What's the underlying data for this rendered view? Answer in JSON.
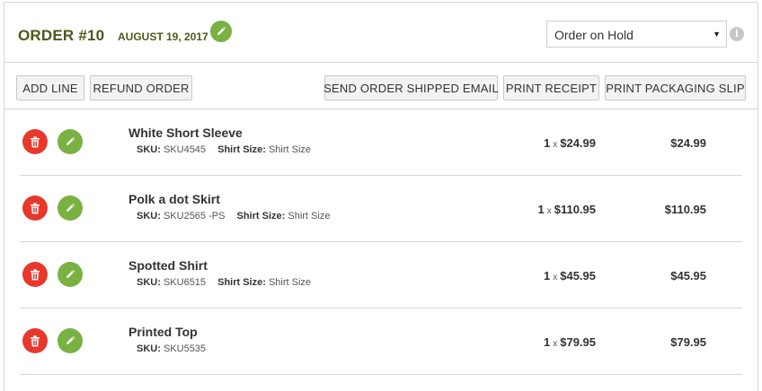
{
  "header": {
    "title": "ORDER #10",
    "date": "AUGUST 19, 2017",
    "status_selected": "Order on Hold",
    "info_icon_glyph": "i"
  },
  "toolbar": {
    "add_line": "ADD LINE",
    "refund_order": "REFUND ORDER",
    "send_shipped_email": "SEND ORDER SHIPPED EMAIL",
    "print_receipt": "PRINT RECEIPT",
    "print_packaging_slip": "PRINT PACKAGING SLIP"
  },
  "line_items": [
    {
      "name": "White Short Sleeve",
      "sku_label": "SKU:",
      "sku": "SKU4545",
      "size_label": "Shirt Size:",
      "size": "Shirt Size",
      "qty": "1",
      "x": "x",
      "unit_price": "$24.99",
      "total": "$24.99"
    },
    {
      "name": "Polk a dot Skirt",
      "sku_label": "SKU:",
      "sku": "SKU2565 -PS",
      "size_label": "Shirt Size:",
      "size": "Shirt Size",
      "qty": "1",
      "x": "x",
      "unit_price": "$110.95",
      "total": "$110.95"
    },
    {
      "name": "Spotted Shirt",
      "sku_label": "SKU:",
      "sku": "SKU6515",
      "size_label": "Shirt Size:",
      "size": "Shirt Size",
      "qty": "1",
      "x": "x",
      "unit_price": "$45.95",
      "total": "$45.95"
    },
    {
      "name": "Printed Top",
      "sku_label": "SKU:",
      "sku": "SKU5535",
      "qty": "1",
      "x": "x",
      "unit_price": "$79.95",
      "total": "$79.95"
    }
  ],
  "colors": {
    "title_green": "#4a5a1b",
    "edit_green": "#79b143",
    "delete_red": "#e8382c",
    "border": "#d6d6d6",
    "button_bg": "#f3f3f3"
  },
  "icons": {
    "edit": "pencil-icon",
    "delete": "trash-icon",
    "info": "info-icon",
    "caret": "caret-down-icon"
  }
}
